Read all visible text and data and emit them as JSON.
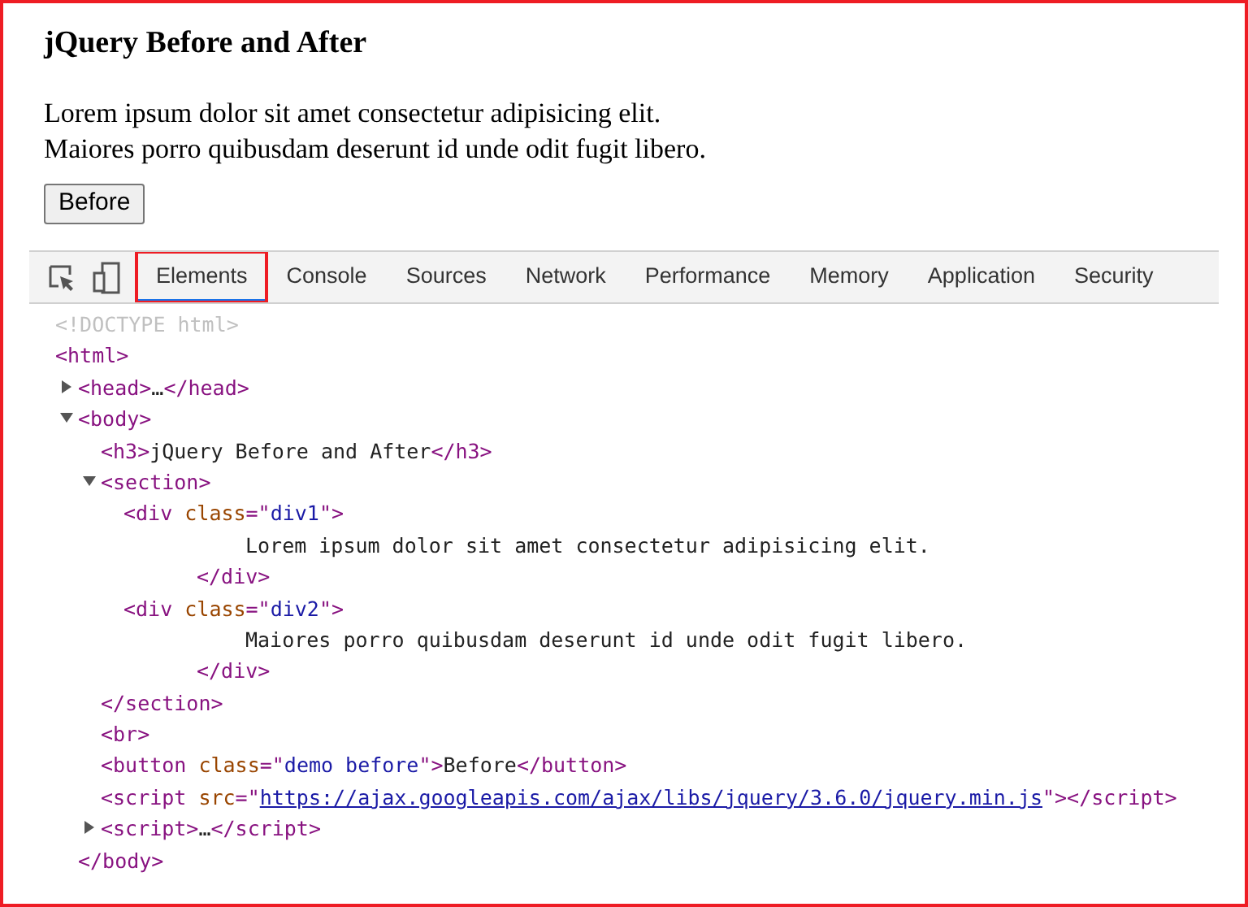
{
  "page": {
    "heading": "jQuery Before and After",
    "paragraphs": [
      "Lorem ipsum dolor sit amet consectetur adipisicing elit.",
      "Maiores porro quibusdam deserunt id unde odit fugit libero."
    ],
    "button": "Before"
  },
  "devtools": {
    "tabs": [
      {
        "label": "Elements",
        "selected": true,
        "annotated": true
      },
      {
        "label": "Console",
        "selected": false,
        "annotated": false
      },
      {
        "label": "Sources",
        "selected": false,
        "annotated": false
      },
      {
        "label": "Network",
        "selected": false,
        "annotated": false
      },
      {
        "label": "Performance",
        "selected": false,
        "annotated": false
      },
      {
        "label": "Memory",
        "selected": false,
        "annotated": false
      },
      {
        "label": "Application",
        "selected": false,
        "annotated": false
      },
      {
        "label": "Security",
        "selected": false,
        "annotated": false
      }
    ],
    "tree": [
      {
        "kind": "element",
        "tokens": [
          {
            "kind": "doctype",
            "s": "<!DOCTYPE html>"
          }
        ]
      },
      {
        "kind": "element",
        "tokens": [
          {
            "kind": "tag",
            "s": "<html>"
          }
        ],
        "children": [
          {
            "kind": "element",
            "expanded": false,
            "tokens": [
              {
                "kind": "tag",
                "s": "<head>"
              },
              {
                "kind": "text",
                "s": "…"
              },
              {
                "kind": "tag",
                "s": "</head>"
              }
            ]
          },
          {
            "kind": "element",
            "expanded": true,
            "tokens": [
              {
                "kind": "tag",
                "s": "<body>"
              }
            ],
            "children": [
              {
                "kind": "element",
                "tokens": [
                  {
                    "kind": "tag",
                    "s": "<h3>"
                  },
                  {
                    "kind": "text",
                    "s": "jQuery Before and After"
                  },
                  {
                    "kind": "tag",
                    "s": "</h3>"
                  }
                ]
              },
              {
                "kind": "element",
                "expanded": true,
                "tokens": [
                  {
                    "kind": "tag",
                    "s": "<section>"
                  }
                ],
                "children": [
                  {
                    "kind": "element",
                    "tokens": [
                      {
                        "kind": "tag",
                        "s": "<div "
                      },
                      {
                        "kind": "attr",
                        "s": "class"
                      },
                      {
                        "kind": "tag",
                        "s": "=\""
                      },
                      {
                        "kind": "value",
                        "s": "div1"
                      },
                      {
                        "kind": "tag",
                        "s": "\">"
                      }
                    ],
                    "children": [
                      {
                        "kind": "text",
                        "tokens": [
                          {
                            "kind": "text",
                            "s": "Lorem ipsum dolor sit amet consectetur adipisicing elit."
                          }
                        ]
                      }
                    ],
                    "closing": [
                      {
                        "kind": "tag",
                        "s": "</div>"
                      }
                    ]
                  },
                  {
                    "kind": "element",
                    "tokens": [
                      {
                        "kind": "tag",
                        "s": "<div "
                      },
                      {
                        "kind": "attr",
                        "s": "class"
                      },
                      {
                        "kind": "tag",
                        "s": "=\""
                      },
                      {
                        "kind": "value",
                        "s": "div2"
                      },
                      {
                        "kind": "tag",
                        "s": "\">"
                      }
                    ],
                    "children": [
                      {
                        "kind": "text",
                        "tokens": [
                          {
                            "kind": "text",
                            "s": "Maiores porro quibusdam deserunt id unde odit fugit libero."
                          }
                        ]
                      }
                    ],
                    "closing": [
                      {
                        "kind": "tag",
                        "s": "</div>"
                      }
                    ]
                  }
                ],
                "closing": [
                  {
                    "kind": "tag",
                    "s": "</section>"
                  }
                ]
              },
              {
                "kind": "element",
                "tokens": [
                  {
                    "kind": "tag",
                    "s": "<br>"
                  }
                ]
              },
              {
                "kind": "element",
                "tokens": [
                  {
                    "kind": "tag",
                    "s": "<button "
                  },
                  {
                    "kind": "attr",
                    "s": "class"
                  },
                  {
                    "kind": "tag",
                    "s": "=\""
                  },
                  {
                    "kind": "value",
                    "s": "demo before"
                  },
                  {
                    "kind": "tag",
                    "s": "\">"
                  },
                  {
                    "kind": "text",
                    "s": "Before"
                  },
                  {
                    "kind": "tag",
                    "s": "</button>"
                  }
                ]
              },
              {
                "kind": "element",
                "tokens": [
                  {
                    "kind": "tag",
                    "s": "<script "
                  },
                  {
                    "kind": "attr",
                    "s": "src"
                  },
                  {
                    "kind": "tag",
                    "s": "=\""
                  },
                  {
                    "kind": "link",
                    "s": "https://ajax.googleapis.com/ajax/libs/jquery/3.6.0/jquery.min.js"
                  },
                  {
                    "kind": "tag",
                    "s": "\"></script>"
                  }
                ]
              },
              {
                "kind": "element",
                "expanded": false,
                "tokens": [
                  {
                    "kind": "tag",
                    "s": "<script>"
                  },
                  {
                    "kind": "text",
                    "s": "…"
                  },
                  {
                    "kind": "tag",
                    "s": "</script>"
                  }
                ]
              }
            ],
            "closing": [
              {
                "kind": "tag",
                "s": "</body>"
              }
            ]
          }
        ]
      }
    ]
  }
}
